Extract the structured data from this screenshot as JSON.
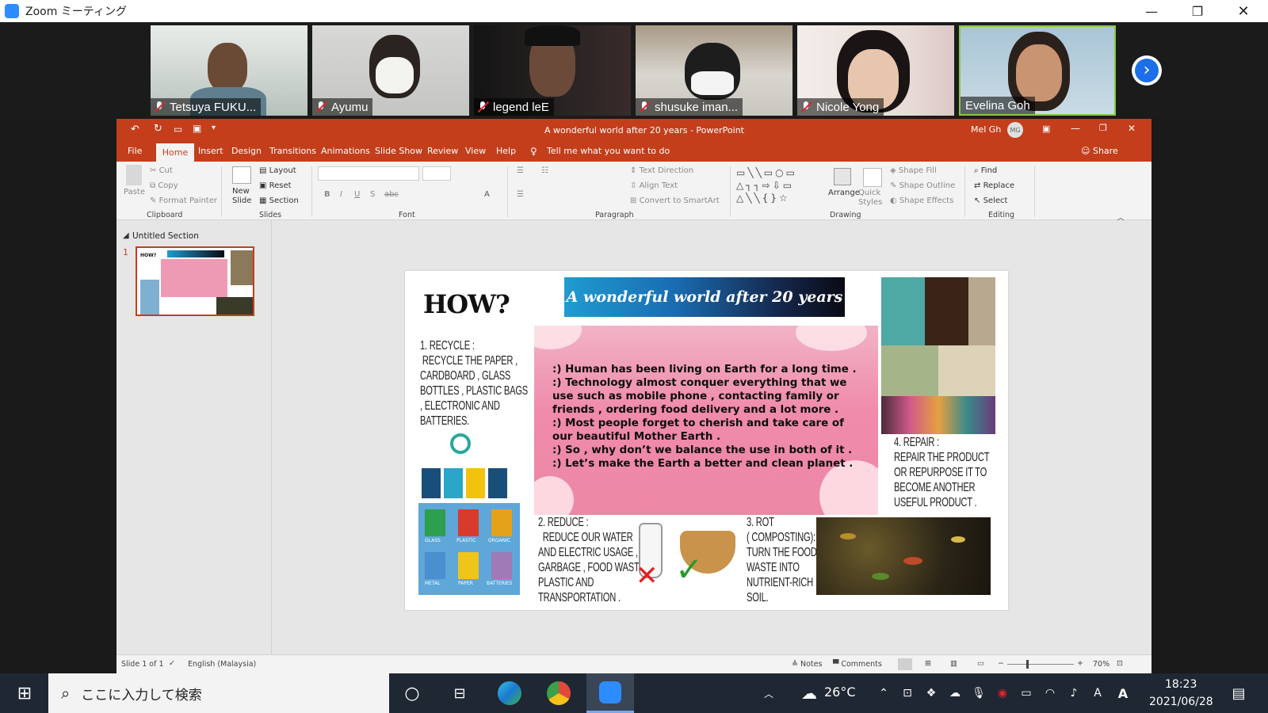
{
  "zoom": {
    "window_title": "Zoom ミーティング",
    "participants": [
      {
        "name": "Tetsuya FUKU..."
      },
      {
        "name": "Ayumu"
      },
      {
        "name": "legend leE"
      },
      {
        "name": "shusuke iman..."
      },
      {
        "name": "Nicole Yong"
      },
      {
        "name": "Evelina Goh"
      }
    ],
    "next_page": "›"
  },
  "ppt": {
    "title": "A wonderful world after 20 years  -  PowerPoint",
    "user": "Mel Gh",
    "user_initials": "MG",
    "tabs": [
      "File",
      "Home",
      "Insert",
      "Design",
      "Transitions",
      "Animations",
      "Slide Show",
      "Review",
      "View",
      "Help"
    ],
    "tell_me": "Tell me what you want to do",
    "share": "Share",
    "ribbon": {
      "clipboard": {
        "paste": "Paste",
        "cut": "Cut",
        "copy": "Copy",
        "format_painter": "Format Painter",
        "label": "Clipboard"
      },
      "slides": {
        "new_slide": "New Slide",
        "layout": "Layout",
        "reset": "Reset",
        "section": "Section",
        "label": "Slides"
      },
      "font": {
        "label": "Font"
      },
      "paragraph": {
        "text_direction": "Text Direction",
        "align_text": "Align Text",
        "smartart": "Convert to SmartArt",
        "label": "Paragraph"
      },
      "drawing": {
        "arrange": "Arrange",
        "quick_styles": "Quick Styles",
        "shape_fill": "Shape Fill",
        "shape_outline": "Shape Outline",
        "shape_effects": "Shape Effects",
        "label": "Drawing"
      },
      "editing": {
        "find": "Find",
        "replace": "Replace",
        "select": "Select",
        "label": "Editing"
      }
    },
    "section_name": "Untitled Section",
    "slide_number": "1",
    "status": {
      "slide": "Slide 1 of 1",
      "language": "English (Malaysia)",
      "notes": "Notes",
      "comments": "Comments",
      "zoom": "70%"
    }
  },
  "slide": {
    "how": "HOW?",
    "banner": "A wonderful world after 20 years",
    "recycle": "1. RECYCLE :\n RECYCLE THE PAPER ,\nCARDBOARD , GLASS\nBOTTLES , PLASTIC BAGS\n, ELECTRONIC AND\nBATTERIES.",
    "main_text": ":) Human has been living on Earth for a long time .\n:) Technology almost conquer everything that we\nuse such as mobile phone , contacting family or\nfriends , ordering food delivery and a lot more .\n:) Most people forget to cherish and take care of\nour beautiful Mother Earth .\n:) So , why don’t we balance the use in both of it .\n:) Let’s make the Earth a better and clean planet .",
    "reduce": "2. REDUCE :\n  REDUCE OUR WATER\nAND ELECTRIC USAGE ,\nGARBAGE , FOOD WASTE\nPLASTIC AND\nTRANSPORTATION .",
    "rot": "3. ROT\n( COMPOSTING):\nTURN THE FOOD\nWASTE INTO\nNUTRIENT-RICH\nSOIL.",
    "repair": "4. REPAIR :\nREPAIR THE PRODUCT\nOR REPURPOSE IT TO\nBECOME ANOTHER\nUSEFUL PRODUCT .",
    "bins": [
      "GLASS",
      "PLASTIC",
      "ORGANIC",
      "METAL",
      "PAPER",
      "BATTERIES"
    ]
  },
  "taskbar": {
    "search_placeholder": "ここに入力して検索",
    "weather": "26°C",
    "time": "18:23",
    "date": "2021/06/28"
  },
  "colors": {
    "ppt_accent": "#c43e1c",
    "zoom_blue": "#2d8cff",
    "taskbar": "#1f2733"
  }
}
